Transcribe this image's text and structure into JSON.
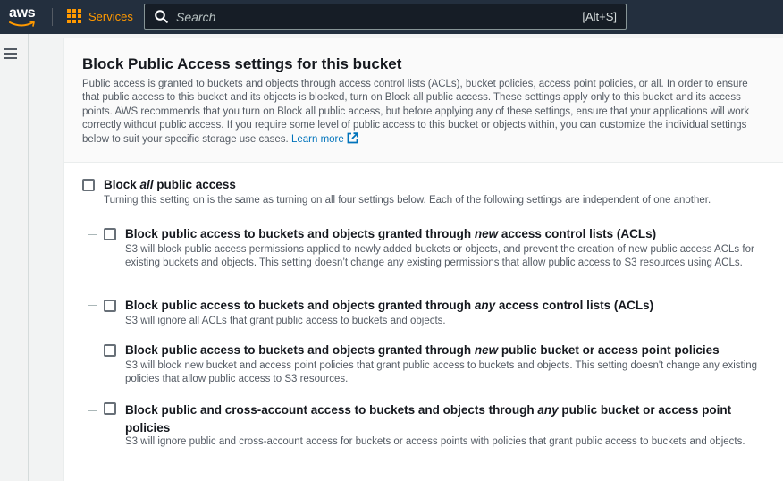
{
  "topnav": {
    "logo_text": "aws",
    "services_label": "Services",
    "search_placeholder": "Search",
    "search_shortcut": "[Alt+S]"
  },
  "panel": {
    "title": "Block Public Access settings for this bucket",
    "description": "Public access is granted to buckets and objects through access control lists (ACLs), bucket policies, access point policies, or all. In order to ensure that public access to this bucket and its objects is blocked, turn on Block all public access. These settings apply only to this bucket and its access points. AWS recommends that you turn on Block all public access, but before applying any of these settings, ensure that your applications will work correctly without public access. If you require some level of public access to this bucket or objects within, you can customize the individual settings below to suit your specific storage use cases.",
    "learn_more": "Learn more"
  },
  "block_all": {
    "label_pre": "Block ",
    "label_em": "all",
    "label_post": " public access",
    "desc": "Turning this setting on is the same as turning on all four settings below. Each of the following settings are independent of one another.",
    "checked": false
  },
  "options": [
    {
      "label_pre": "Block public access to buckets and objects granted through ",
      "label_em": "new",
      "label_post": " access control lists (ACLs)",
      "desc": "S3 will block public access permissions applied to newly added buckets or objects, and prevent the creation of new public access ACLs for existing buckets and objects. This setting doesn’t change any existing permissions that allow public access to S3 resources using ACLs.",
      "checked": false
    },
    {
      "label_pre": "Block public access to buckets and objects granted through ",
      "label_em": "any",
      "label_post": " access control lists (ACLs)",
      "desc": "S3 will ignore all ACLs that grant public access to buckets and objects.",
      "checked": false
    },
    {
      "label_pre": "Block public access to buckets and objects granted through ",
      "label_em": "new",
      "label_post": " public bucket or access point policies",
      "desc": "S3 will block new bucket and access point policies that grant public access to buckets and objects. This setting doesn't change any existing policies that allow public access to S3 resources.",
      "checked": false
    },
    {
      "label_pre": "Block public and cross-account access to buckets and objects through ",
      "label_em": "any",
      "label_post": " public bucket or access point policies",
      "desc": "S3 will ignore public and cross-account access for buckets or access points with policies that grant public access to buckets and objects.",
      "checked": false
    }
  ]
}
